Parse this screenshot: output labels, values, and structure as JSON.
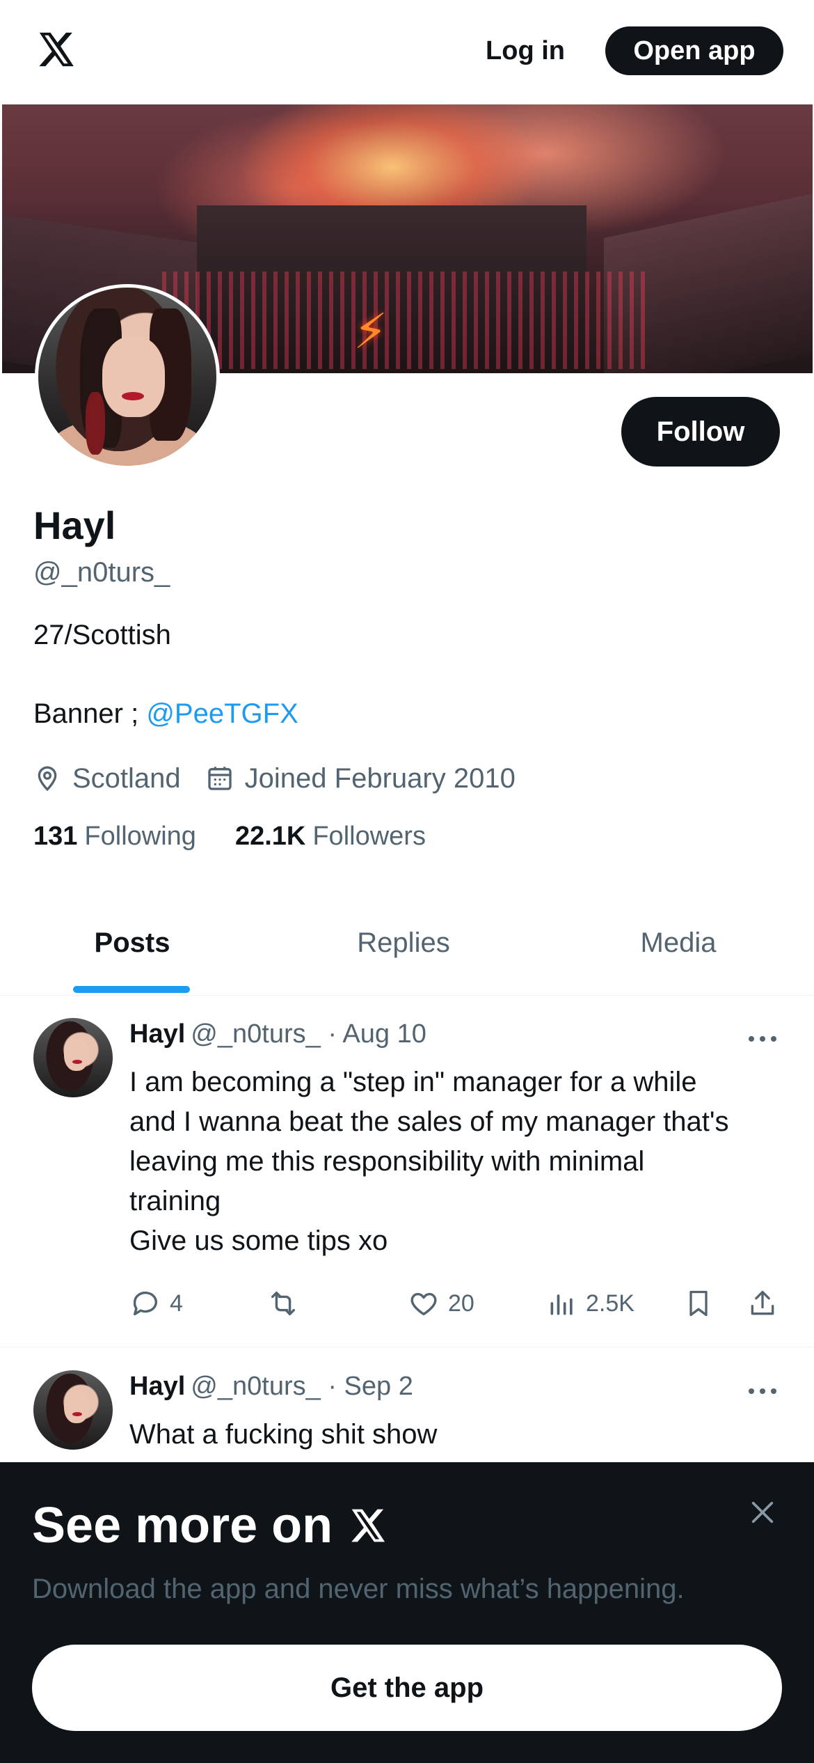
{
  "header": {
    "login_label": "Log in",
    "open_app_label": "Open app"
  },
  "profile": {
    "name": "Hayl",
    "handle": "@_n0turs_",
    "bio_line1": "27/Scottish",
    "bio_line2_prefix": "Banner ; ",
    "bio_line2_mention": "@PeeTGFX",
    "location": "Scotland",
    "joined": "Joined February 2010",
    "following_count": "131",
    "following_label": "Following",
    "followers_count": "22.1K",
    "followers_label": "Followers",
    "follow_label": "Follow"
  },
  "tabs": [
    {
      "label": "Posts",
      "active": true
    },
    {
      "label": "Replies",
      "active": false
    },
    {
      "label": "Media",
      "active": false
    }
  ],
  "posts": [
    {
      "name": "Hayl",
      "handle": "@_n0turs_",
      "date": "· Aug 10",
      "lines": [
        "I am becoming a \"step in\" manager for a while",
        "and I wanna beat the sales of my manager that's",
        "leaving me this responsibility with minimal",
        "training",
        "Give us some tips xo"
      ],
      "replies": "4",
      "likes": "20",
      "views": "2.5K"
    },
    {
      "name": "Hayl",
      "handle": "@_n0turs_",
      "date": "· Sep 2",
      "lines": [
        "What a fucking shit show"
      ]
    }
  ],
  "sheet": {
    "title": "See more on",
    "subtitle": "Download the app and never miss what’s happening.",
    "button_label": "Get the app"
  },
  "colors": {
    "accent": "#1d9bf0",
    "text": "#0f1419",
    "muted": "#536471",
    "dark": "#0f1419"
  },
  "icons": [
    "x-logo-icon",
    "location-icon",
    "calendar-icon",
    "more-icon",
    "reply-icon",
    "repost-icon",
    "like-icon",
    "views-icon",
    "bookmark-icon",
    "share-icon",
    "close-icon"
  ]
}
